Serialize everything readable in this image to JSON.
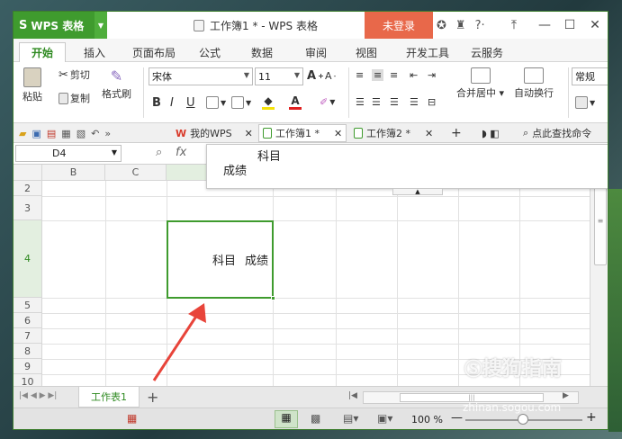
{
  "app": {
    "name": "WPS 表格",
    "doc_title": "工作簿1 * - WPS 表格",
    "login_label": "未登录"
  },
  "menu_tabs": [
    "开始",
    "插入",
    "页面布局",
    "公式",
    "数据",
    "审阅",
    "视图",
    "开发工具",
    "云服务"
  ],
  "ribbon": {
    "paste": "粘贴",
    "cut": "剪切",
    "copy": "复制",
    "format_painter": "格式刷",
    "font_name": "宋体",
    "font_size": "11",
    "bold": "B",
    "italic": "I",
    "underline": "U",
    "merge_center": "合并居中",
    "wrap_text": "自动换行",
    "number_format": "常规"
  },
  "doc_tabs": [
    {
      "label": "我的WPS"
    },
    {
      "label": "工作簿1 *"
    },
    {
      "label": "工作簿2 *"
    }
  ],
  "search_cmd": "点此查找命令",
  "formula_bar": {
    "name_box": "D4",
    "fx": "fx",
    "line1": "科目",
    "line2": "成绩"
  },
  "columns": [
    "B",
    "C"
  ],
  "rows": [
    "2",
    "3",
    "4",
    "5",
    "6",
    "7",
    "8",
    "9",
    "10"
  ],
  "active_cell": {
    "text1": "科目",
    "text2": "成绩"
  },
  "sheet_tab": "工作表1",
  "zoom": "100 %",
  "watermark": "搜狗指南",
  "watermark_url": "zhinan.sogou.com",
  "colors": {
    "accent": "#3f9b2e",
    "login": "#e8684a",
    "arrow": "#e8443a"
  }
}
